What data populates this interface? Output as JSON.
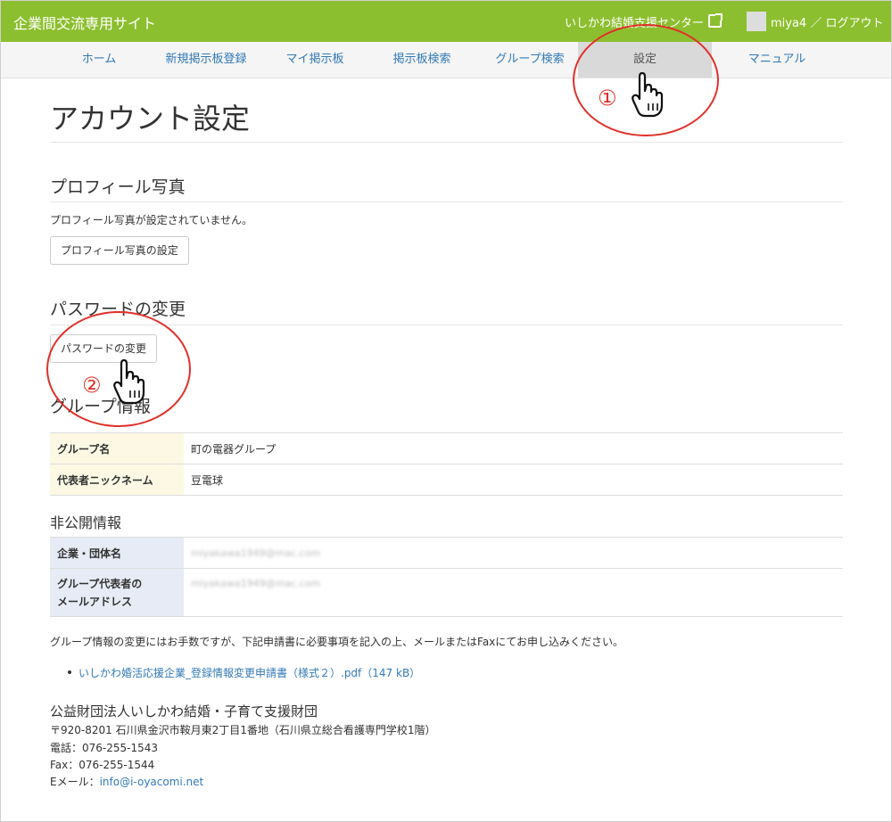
{
  "header": {
    "site_title": "企業間交流専用サイト",
    "center_link": "いしかわ結婚支援センター",
    "user_name": "miya4",
    "logout_label": "／ ログアウト"
  },
  "nav": {
    "items": [
      {
        "label": "ホーム"
      },
      {
        "label": "新規掲示板登録"
      },
      {
        "label": "マイ掲示板"
      },
      {
        "label": "掲示板検索"
      },
      {
        "label": "グループ検索"
      },
      {
        "label": "設定"
      },
      {
        "label": "マニュアル"
      }
    ]
  },
  "page": {
    "title": "アカウント設定"
  },
  "profile_photo": {
    "title": "プロフィール写真",
    "status_text": "プロフィール写真が設定されていません。",
    "button_label": "プロフィール写真の設定"
  },
  "password": {
    "title": "パスワードの変更",
    "button_label": "パスワードの変更"
  },
  "group_info": {
    "title": "グループ情報",
    "rows": [
      {
        "label": "グループ名",
        "value": "町の電器グループ"
      },
      {
        "label": "代表者ニックネーム",
        "value": "豆電球"
      }
    ]
  },
  "private_info": {
    "title": "非公開情報",
    "rows": [
      {
        "label": "企業・団体名",
        "value": "miyakawa1949@mac.com"
      },
      {
        "label_line1": "グループ代表者の",
        "label_line2": "メールアドレス",
        "value": "miyakawa1949@mac.com"
      }
    ]
  },
  "notice": {
    "text": "グループ情報の変更にはお手数ですが、下記申請書に必要事項を記入の上、メールまたはFaxにてお申し込みください。",
    "link_text": "いしかわ婚活応援企業_登録情報変更申請書（様式２）.pdf",
    "link_size": "（147 kB）"
  },
  "footer": {
    "org": "公益財団法人いしかわ結婚・子育て支援財団",
    "address": "〒920-8201 石川県金沢市鞍月東2丁目1番地（石川県立総合看護専門学校1階）",
    "phone": "電話：076-255-1543",
    "fax": "Fax：076-255-1544",
    "email_label": "Eメール：",
    "email": "info@i-oyacomi.net"
  },
  "annotations": {
    "step1": "①",
    "step2": "②"
  },
  "colors": {
    "header_bg": "#8cbf2f",
    "link": "#337ab7",
    "annotation": "#e0302a"
  }
}
